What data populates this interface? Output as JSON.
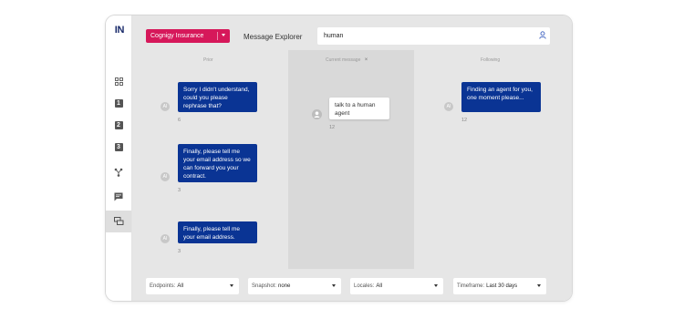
{
  "app": {
    "logo": "IN"
  },
  "header": {
    "project": "Cognigy Insurance",
    "title": "Message Explorer",
    "search_value": "human"
  },
  "sidebar": {
    "items": [
      {
        "icon": "grid-icon"
      },
      {
        "icon": "number-1-icon",
        "label": "1"
      },
      {
        "icon": "number-2-icon",
        "label": "2"
      },
      {
        "icon": "number-3-icon",
        "label": "3"
      },
      {
        "icon": "flow-icon"
      },
      {
        "icon": "chat-icon"
      },
      {
        "icon": "message-explorer-icon",
        "active": true
      }
    ]
  },
  "columns": {
    "prior": "Prior",
    "current": "Current message",
    "current_close": "×",
    "following": "Following"
  },
  "prior_messages": [
    {
      "avatar": "AI",
      "text": "Sorry I didn't understand, could you please rephrase that?",
      "count": "6"
    },
    {
      "avatar": "AI",
      "text": "Finally, please tell me your email address so we can forward you your contract.",
      "count": "3"
    },
    {
      "avatar": "AI",
      "text": "Finally, please tell me your email address.",
      "count": "3"
    }
  ],
  "current_message": {
    "text": "talk to a human agent",
    "count": "12"
  },
  "following_message": {
    "avatar": "AI",
    "text": "Finding an agent for you, one moment please...",
    "count": "12"
  },
  "filters": [
    {
      "label": "Endpoints:",
      "value": "All"
    },
    {
      "label": "Snapshot:",
      "value": "none"
    },
    {
      "label": "Locales:",
      "value": "All"
    },
    {
      "label": "Timeframe:",
      "value": "Last 30 days"
    }
  ],
  "colors": {
    "brand_pink": "#d6185a",
    "bubble_blue": "#0a3494",
    "background": "#e6e6e6"
  }
}
